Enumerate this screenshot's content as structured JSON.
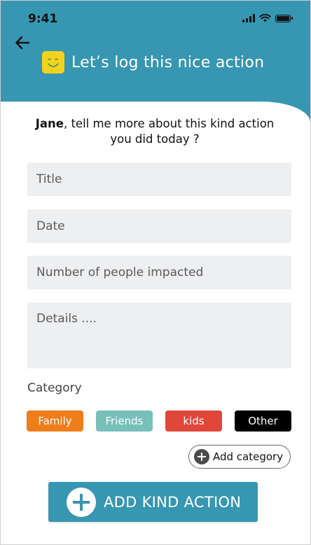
{
  "status_bar": {
    "time": "9:41"
  },
  "header": {
    "title": "Let’s log this nice action"
  },
  "intro": {
    "name": "Jane",
    "text_line1": ", tell me more about this kind action",
    "text_line2": "you did today ?"
  },
  "form": {
    "title_placeholder": "Title",
    "date_placeholder": "Date",
    "people_placeholder": "Number of people impacted",
    "details_placeholder": "Details ...."
  },
  "category": {
    "label": "Category",
    "chips": [
      {
        "label": "Family",
        "color": "#ef7d1a"
      },
      {
        "label": "Friends",
        "color": "#77c0b9"
      },
      {
        "label": "kids",
        "color": "#e0473b"
      },
      {
        "label": "Other",
        "color": "#000000"
      }
    ],
    "add_label": "Add category"
  },
  "submit": {
    "label": "ADD KIND ACTION"
  },
  "colors": {
    "accent": "#3796b1",
    "smiley": "#f3d21c",
    "field_bg": "#eeeff1"
  }
}
